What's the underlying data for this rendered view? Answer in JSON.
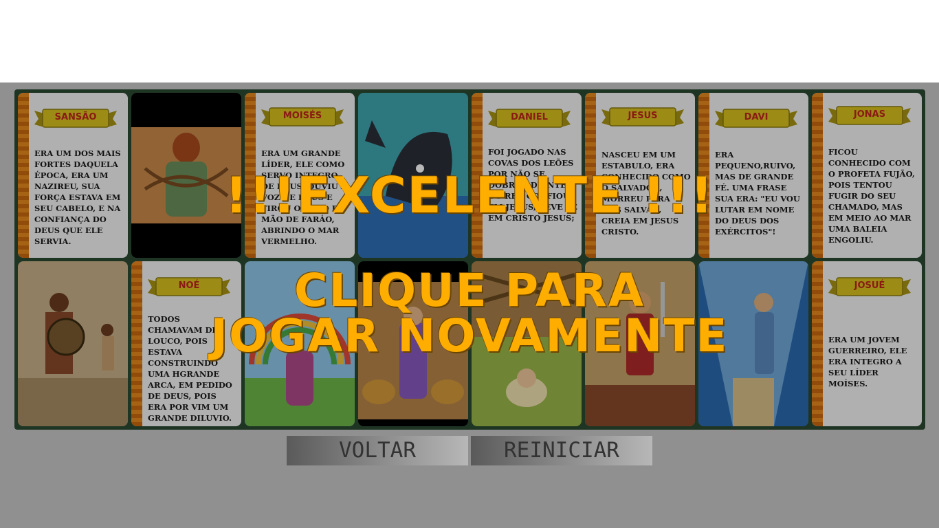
{
  "game": {
    "cards_top": [
      {
        "kind": "text",
        "name": "SANSÃO",
        "text": "ERA UM DOS MAIS FORTES DAQUELA ÉPOCA, ERA UM NAZIREU, SUA FORÇA ESTAVA EM SEU CABELO, E NA CONFIANÇA DO DEUS QUE ELE SERVIA."
      },
      {
        "kind": "image",
        "subject": "sansao-chained-picture"
      },
      {
        "kind": "text",
        "name": "MOISÉS",
        "text": "ERA UM GRANDE LÍDER, ELE COMO SERVO INTEGRO DE DEUS, OUVIU A VOZ DE DEUS E TIROU O POVO DA MÃO DE FARÁO, ABRINDO O MAR VERMELHO."
      },
      {
        "kind": "image",
        "subject": "jonas-whale-picture"
      },
      {
        "kind": "text",
        "name": "DANIEL",
        "text": "FOI JOGADO NAS COVAS DOS LEÕES POR NÃO SE DOBRAR DIANTE DO REI, CONFIOU EM JESUS, TEVE FÉ EM CRISTO JESUS;"
      },
      {
        "kind": "text",
        "name": "JESUS",
        "text": "NASCEU EM UM ESTABULO, ERA CONHECIDO COMO O SALVADOR, MORREU PARA NOS SALVAR, CREIA EM JESUS CRISTO."
      },
      {
        "kind": "text",
        "name": "DAVI",
        "text": "ERA PEQUENO,RUIVO, MAS DE GRANDE FÉ. UMA FRASE SUA ERA: \"EU VOU LUTAR EM NOME DO DEUS DOS EXÉRCITOS\"!"
      },
      {
        "kind": "text",
        "name": "JONAS",
        "text": "FICOU CONHECIDO COM O PROFETA FUJÃO, POIS TENTOU FUGIR DO SEU CHAMADO, MAS EM MEIO AO MAR UMA BALEIA ENGOLIU."
      }
    ],
    "cards_bottom": [
      {
        "kind": "image",
        "subject": "davi-golias-picture"
      },
      {
        "kind": "text",
        "name": "NOÉ",
        "text": "TODOS CHAMAVAM DE LOUCO, POIS ESTAVA CONSTRUINDO UMA HGRANDE ARCA, EM PEDIDO DE DEUS, POIS ERA POR VIM UM GRANDE DILUVIO."
      },
      {
        "kind": "image",
        "subject": "noe-ark-picture"
      },
      {
        "kind": "image",
        "subject": "daniel-lions-picture"
      },
      {
        "kind": "image",
        "subject": "jesus-manger-picture"
      },
      {
        "kind": "image",
        "subject": "josue-soldier-picture"
      },
      {
        "kind": "image",
        "subject": "moises-sea-picture"
      },
      {
        "kind": "text",
        "name": "JOSUÉ",
        "text": "ERA UM JOVEM GUERREIRO, ELE ERA INTEGRO A SEU LÍDER MOÍSES."
      }
    ]
  },
  "overlay": {
    "title": "!!!EXCELENTE !!!",
    "subtitle_line1": "CLIQUE PARA",
    "subtitle_line2": "JOGAR NOVAMENTE"
  },
  "buttons": {
    "back_label": "VOLTAR",
    "restart_label": "REINICIAR"
  },
  "colors": {
    "board": "#2c4a32",
    "banner_fill": "#d9c21f",
    "banner_text": "#c0241c",
    "message": "#ffae00",
    "spine": "#e88a1e"
  }
}
